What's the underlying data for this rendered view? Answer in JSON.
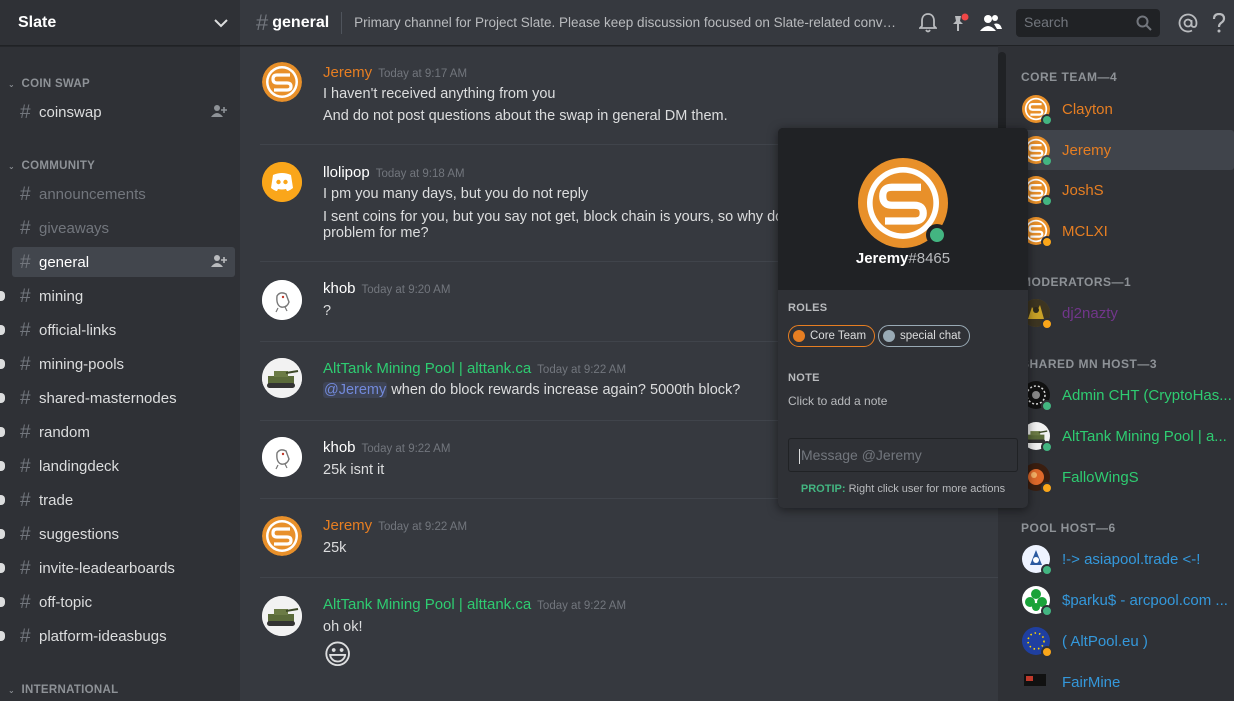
{
  "server": {
    "name": "Slate"
  },
  "sidebar": {
    "categories": [
      "COIN SWAP",
      "COMMUNITY",
      "INTERNATIONAL"
    ],
    "channels": [
      "coinswap",
      "announcements",
      "giveaways",
      "general",
      "mining",
      "official-links",
      "mining-pools",
      "shared-masternodes",
      "random",
      "landingdeck",
      "trade",
      "suggestions",
      "invite-leadearboards",
      "off-topic",
      "platform-ideasbugs"
    ]
  },
  "topbar": {
    "channel": "general",
    "topic": "Primary channel for Project Slate. Please keep discussion focused on Slate-related conversa...",
    "search_placeholder": "Search"
  },
  "messages": [
    {
      "author": "Jeremy",
      "time": "Today at 9:17 AM",
      "lines": [
        "I haven't received anything from you",
        "And do not post questions about the swap in general DM them."
      ]
    },
    {
      "author": "llolipop",
      "time": "Today at 9:18 AM",
      "lines": [
        "I pm you many days, but you do not reply",
        "I sent coins for you, but you say not get, block chain is yours, so why do no",
        "problem for me?"
      ]
    },
    {
      "author": "khob",
      "time": "Today at 9:20 AM",
      "lines": [
        "?"
      ]
    },
    {
      "author": "AltTank Mining Pool | alttank.ca",
      "time": "Today at 9:22 AM",
      "mention": "@Jeremy",
      "lines": [
        " when do block rewards increase again? 5000th block?"
      ]
    },
    {
      "author": "khob",
      "time": "Today at 9:22 AM",
      "lines": [
        "25k isnt it"
      ]
    },
    {
      "author": "Jeremy",
      "time": "Today at 9:22 AM",
      "lines": [
        "25k"
      ]
    },
    {
      "author": "AltTank Mining Pool | alttank.ca",
      "time": "Today at 9:22 AM",
      "lines": [
        "oh ok!"
      ],
      "emoji": "😃"
    }
  ],
  "members": {
    "groups": [
      "CORE TEAM—4",
      "MODERATORS—1",
      "SHARED MN HOST—3",
      "POOL HOST—6"
    ],
    "list": [
      "Clayton",
      "Jeremy",
      "JoshS",
      "MCLXI",
      "dj2nazty",
      "Admin CHT (CryptoHas...",
      "AltTank Mining Pool | a...",
      "FalloWingS",
      "!-> asiapool.trade <-!",
      "$parku$ - arcpool.com ...",
      "( AltPool.eu )",
      "FairMine"
    ]
  },
  "popout": {
    "username": "Jeremy",
    "discriminator": "#8465",
    "roles_label": "ROLES",
    "roles": [
      "Core Team",
      "special chat"
    ],
    "note_label": "NOTE",
    "note_placeholder": "Click to add a note",
    "message_placeholder": "Message @Jeremy",
    "protip_label": "PROTIP:",
    "protip_text": " Right click user for more actions"
  },
  "colors": {
    "core_team": "#e67e22",
    "moderator": "#71368a",
    "shared_mn": "#2ecc71",
    "pool_host": "#3498db",
    "online": "#43b581",
    "idle": "#faa61a"
  }
}
